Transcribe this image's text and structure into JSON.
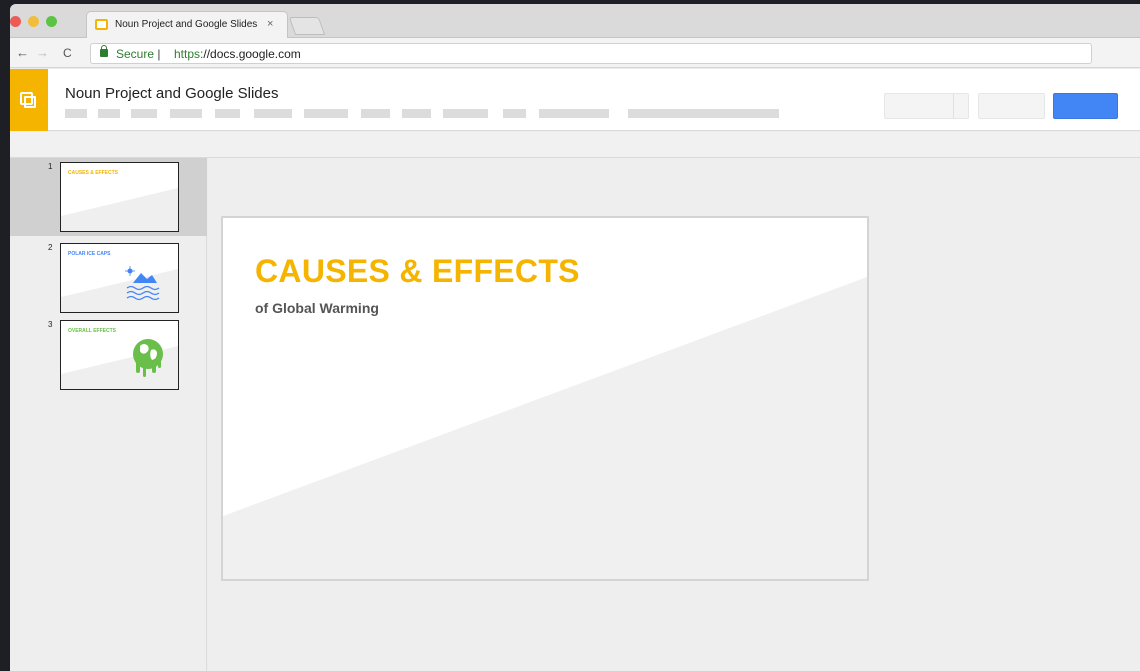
{
  "browser": {
    "tab_title": "Noun Project and Google Slides",
    "tab_close": "×",
    "secure_label": "Secure",
    "url_separator": "|",
    "url_scheme": "https:",
    "url_rest": "//docs.google.com"
  },
  "app": {
    "document_title": "Noun Project and Google Slides",
    "accent_color": "#f4b400",
    "primary_button_color": "#4285f4"
  },
  "filmstrip": {
    "slides": [
      {
        "number": "1",
        "title": "CAUSES & EFFECTS",
        "title_color": "#f4b400",
        "selected": true
      },
      {
        "number": "2",
        "title": "POLAR ICE CAPS",
        "title_color": "#4285f4",
        "icon": "melting-ice-icon"
      },
      {
        "number": "3",
        "title": "OVERALL EFFECTS",
        "title_color": "#6abf4b",
        "icon": "melting-earth-icon"
      }
    ]
  },
  "slide": {
    "title": "CAUSES & EFFECTS",
    "subtitle": "of Global Warming"
  }
}
